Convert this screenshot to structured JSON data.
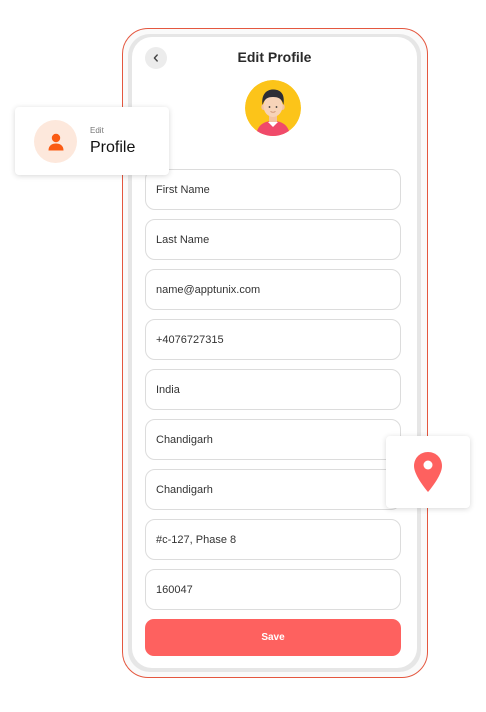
{
  "header": {
    "title": "Edit Profile",
    "back_icon": "chevron-left-icon"
  },
  "avatar": {
    "icon": "user-avatar-illustration"
  },
  "form": {
    "first_name": "First Name",
    "last_name": "Last Name",
    "email": "name@apptunix.com",
    "phone": "+4076727315",
    "country": "India",
    "state": "Chandigarh",
    "city": "Chandigarh",
    "address": "#c-127, Phase 8",
    "postal_code": "160047"
  },
  "save_label": "Save",
  "profile_card": {
    "small_label": "Edit",
    "large_label": "Profile",
    "icon": "person-icon"
  },
  "location_card": {
    "icon": "map-pin-icon"
  },
  "colors": {
    "accent": "#fe615f",
    "frame_border": "#e4573f",
    "profile_icon": "#fa5b14",
    "profile_icon_bg": "#fde8dc",
    "avatar_bg": "#fcc419"
  }
}
